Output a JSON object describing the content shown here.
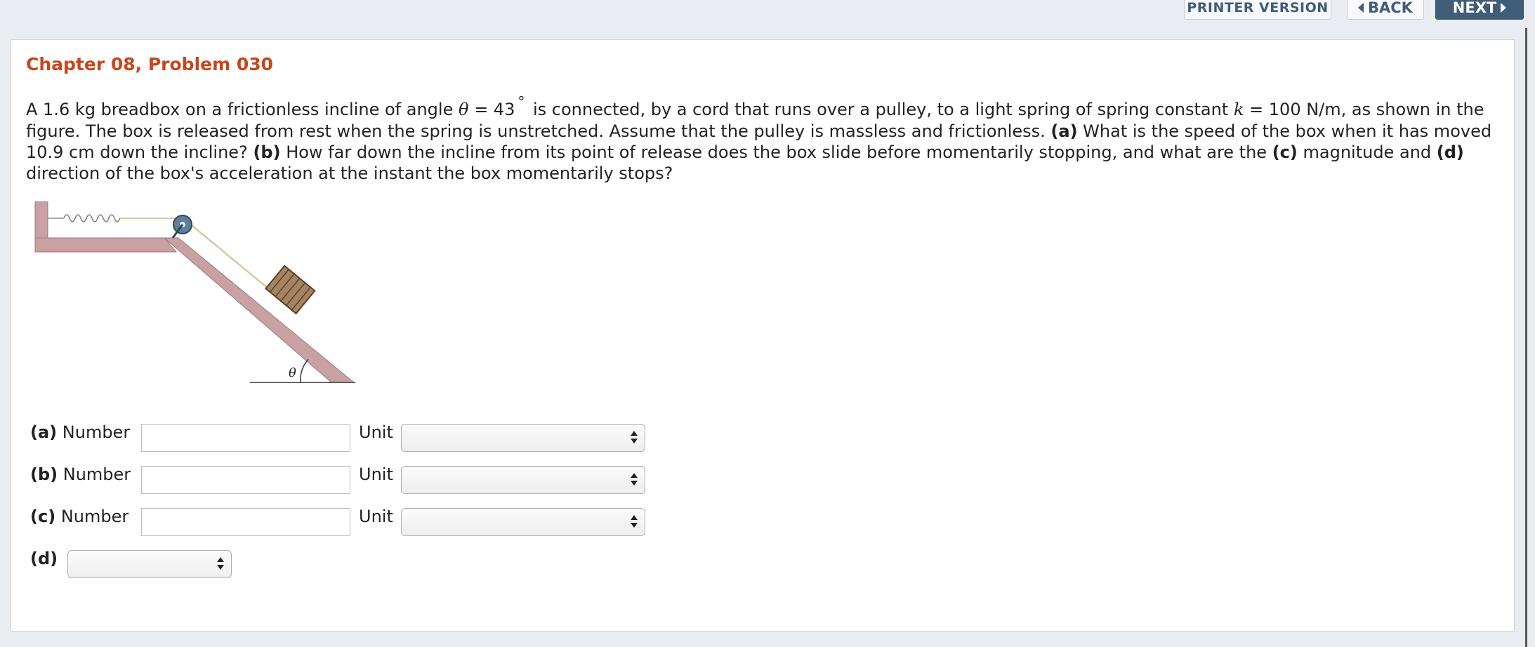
{
  "nav": {
    "printer_label": "PRINTER VERSION",
    "back_label": "BACK",
    "next_label": "NEXT"
  },
  "problem": {
    "title": "Chapter 08, Problem 030",
    "text_1": "A 1.6 kg breadbox on a frictionless incline of angle ",
    "theta": "θ",
    "text_eq_1": " = 43",
    "degree": "°",
    "text_2": " is connected, by a cord that runs over a pulley, to a light spring of spring constant ",
    "k": "k",
    "text_3": " = 100 N/m, as shown in the figure. The box is released from rest when the spring is unstretched. Assume that the pulley is massless and frictionless. ",
    "part_a": "(a)",
    "text_4": " What is the speed of the box when it has moved 10.9 cm down the incline? ",
    "part_b": "(b)",
    "text_5": " How far down the incline from its point of release does the box slide before momentarily stopping, and what are the ",
    "part_c": "(c)",
    "text_6": " magnitude and ",
    "part_d": "(d)",
    "text_7": " direction of the box's acceleration at the instant the box momentarily stops?"
  },
  "figure": {
    "angle_label": "θ"
  },
  "answers": {
    "a": {
      "part": "(a)",
      "label": "Number",
      "value": "",
      "unit_label": "Unit",
      "unit_value": ""
    },
    "b": {
      "part": "(b)",
      "label": "Number",
      "value": "",
      "unit_label": "Unit",
      "unit_value": ""
    },
    "c": {
      "part": "(c)",
      "label": "Number",
      "value": "",
      "unit_label": "Unit",
      "unit_value": ""
    },
    "d": {
      "part": "(d)",
      "value": ""
    }
  },
  "colors": {
    "title": "#c8451d",
    "nav_primary": "#3f5d78",
    "incline": "#c9a0a4"
  }
}
